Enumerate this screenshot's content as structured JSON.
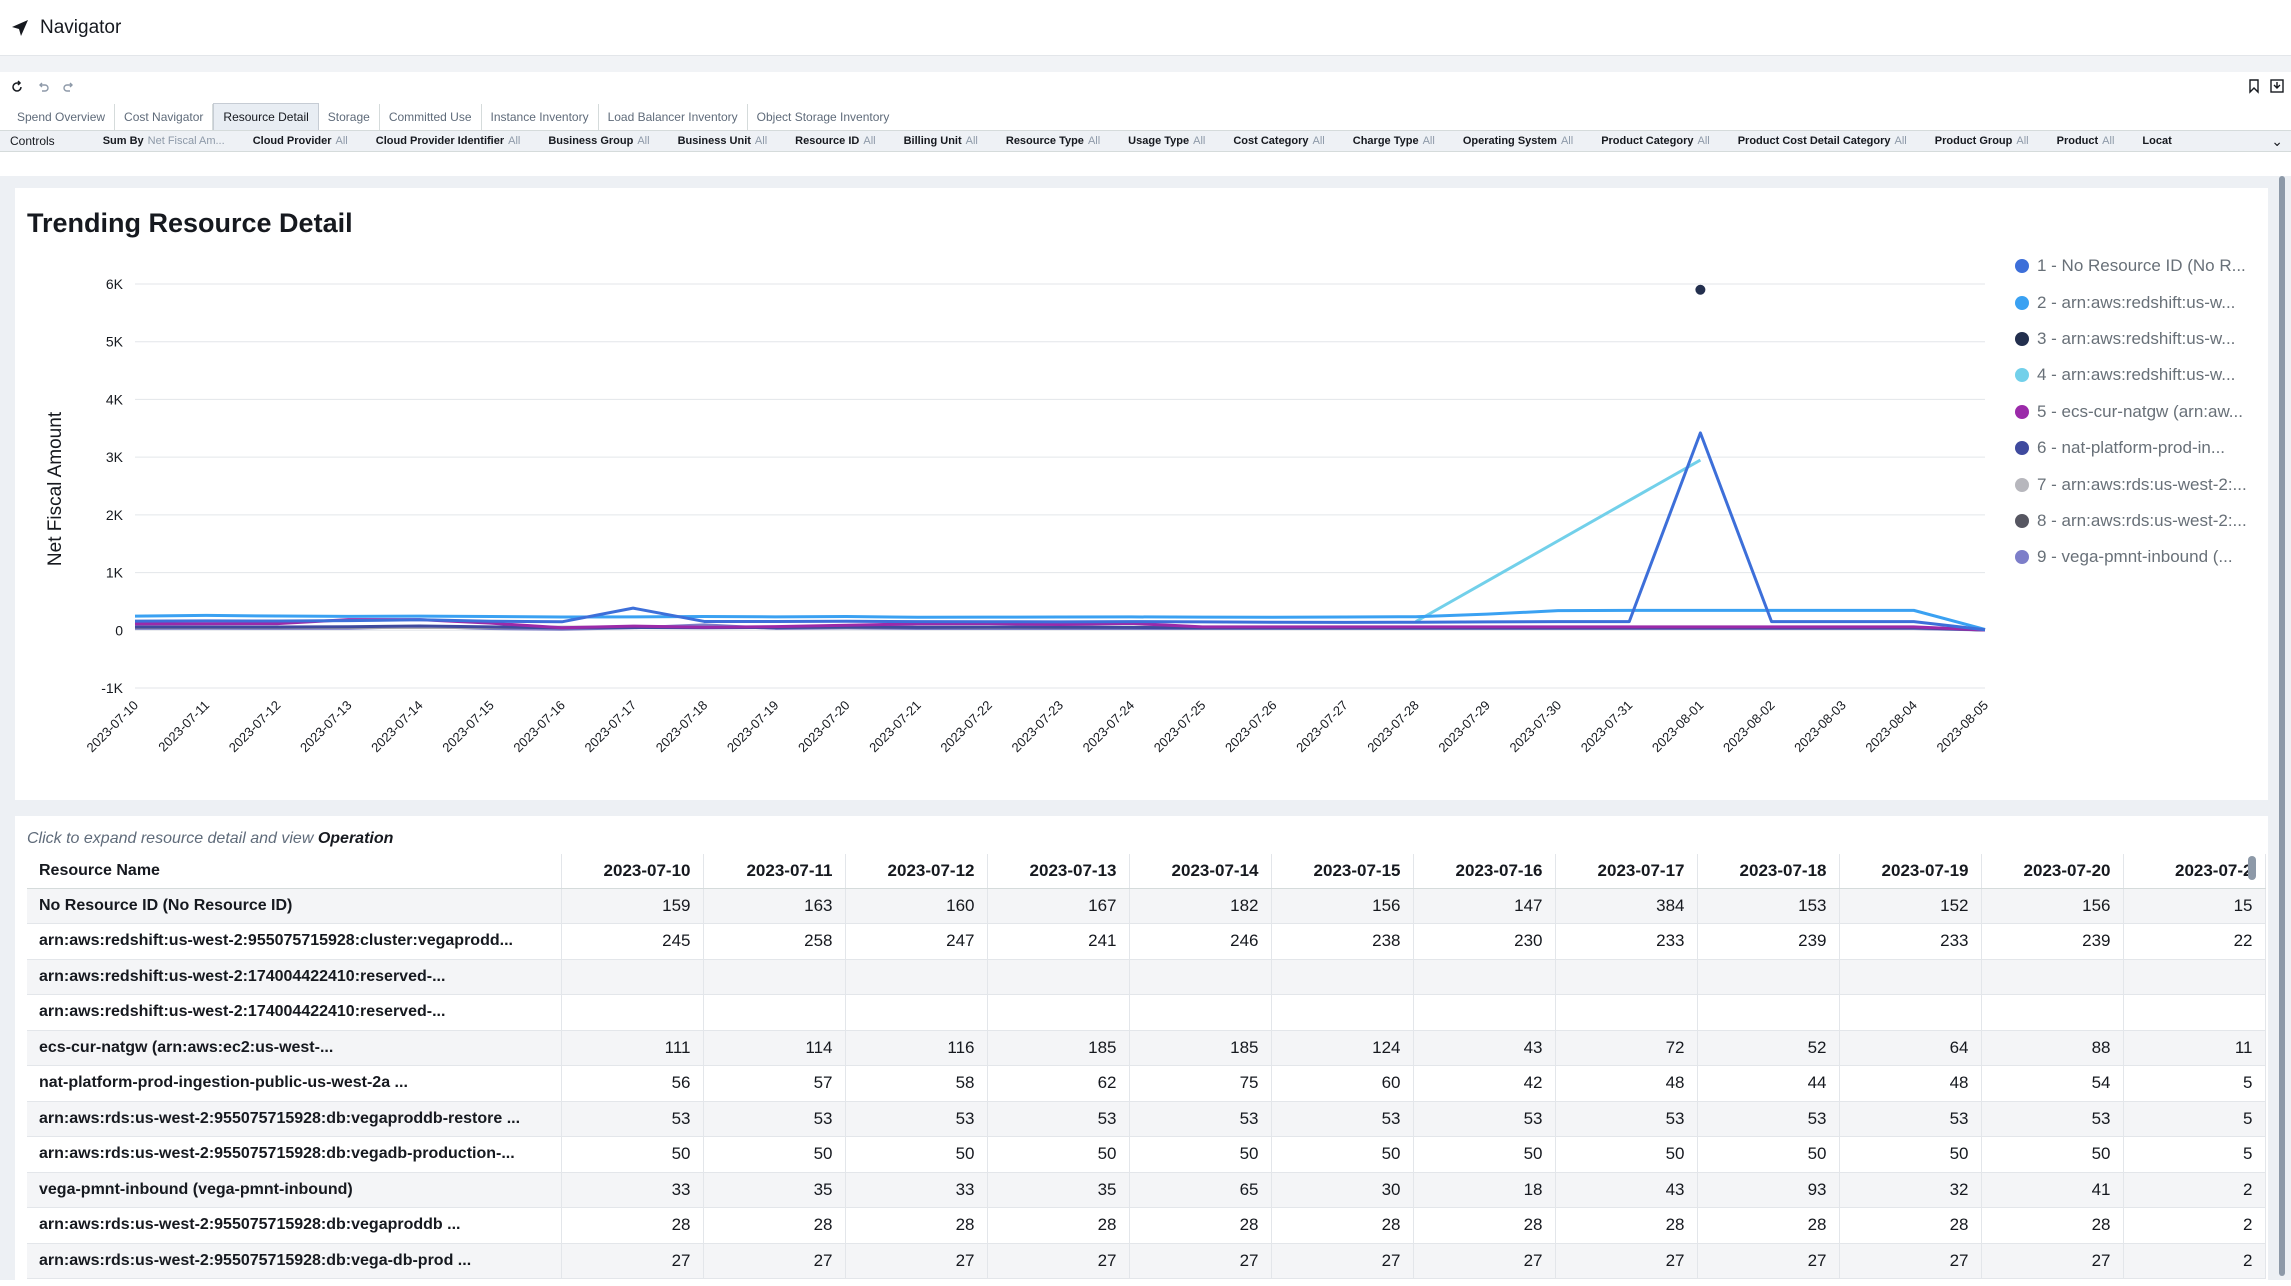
{
  "app": {
    "title": "Navigator"
  },
  "tabs": [
    "Spend Overview",
    "Cost Navigator",
    "Resource Detail",
    "Storage",
    "Committed Use",
    "Instance Inventory",
    "Load Balancer Inventory",
    "Object Storage Inventory"
  ],
  "active_tab": "Resource Detail",
  "controls": {
    "label": "Controls",
    "items": [
      {
        "name": "Sum By",
        "value": "Net Fiscal Am..."
      },
      {
        "name": "Cloud Provider",
        "value": "All"
      },
      {
        "name": "Cloud Provider Identifier",
        "value": "All"
      },
      {
        "name": "Business Group",
        "value": "All"
      },
      {
        "name": "Business Unit",
        "value": "All"
      },
      {
        "name": "Resource ID",
        "value": "All"
      },
      {
        "name": "Billing Unit",
        "value": "All"
      },
      {
        "name": "Resource Type",
        "value": "All"
      },
      {
        "name": "Usage Type",
        "value": "All"
      },
      {
        "name": "Cost Category",
        "value": "All"
      },
      {
        "name": "Charge Type",
        "value": "All"
      },
      {
        "name": "Operating System",
        "value": "All"
      },
      {
        "name": "Product Category",
        "value": "All"
      },
      {
        "name": "Product Cost Detail Category",
        "value": "All"
      },
      {
        "name": "Product Group",
        "value": "All"
      },
      {
        "name": "Product",
        "value": "All"
      },
      {
        "name": "Locat",
        "value": ""
      }
    ]
  },
  "chart": {
    "title": "Trending Resource Detail",
    "ylabel": "Net Fiscal Amount",
    "y_ticks": [
      "6K",
      "5K",
      "4K",
      "3K",
      "2K",
      "1K",
      "0",
      "-1K"
    ]
  },
  "chart_data": {
    "type": "line",
    "title": "Trending Resource Detail",
    "xlabel": "",
    "ylabel": "Net Fiscal Amount",
    "ylim": [
      -1000,
      6000
    ],
    "x": [
      "2023-07-10",
      "2023-07-11",
      "2023-07-12",
      "2023-07-13",
      "2023-07-14",
      "2023-07-15",
      "2023-07-16",
      "2023-07-17",
      "2023-07-18",
      "2023-07-19",
      "2023-07-20",
      "2023-07-21",
      "2023-07-22",
      "2023-07-23",
      "2023-07-24",
      "2023-07-25",
      "2023-07-26",
      "2023-07-27",
      "2023-07-28",
      "2023-07-29",
      "2023-07-30",
      "2023-07-31",
      "2023-08-01",
      "2023-08-02",
      "2023-08-03",
      "2023-08-04",
      "2023-08-05"
    ],
    "legend_position": "right",
    "series": [
      {
        "name": "1 - No Resource ID (No R...",
        "color": "#3d6fd9",
        "values": [
          159,
          163,
          160,
          167,
          182,
          156,
          147,
          384,
          153,
          152,
          156,
          150,
          148,
          146,
          150,
          145,
          140,
          138,
          140,
          145,
          150,
          150,
          3420,
          150,
          150,
          150,
          10
        ]
      },
      {
        "name": "2 - arn:aws:redshift:us-w...",
        "color": "#3aa1f2",
        "values": [
          245,
          258,
          247,
          241,
          246,
          238,
          230,
          233,
          239,
          233,
          239,
          225,
          228,
          230,
          232,
          228,
          225,
          230,
          235,
          280,
          340,
          345,
          345,
          345,
          345,
          345,
          15
        ]
      },
      {
        "name": "3 - arn:aws:redshift:us-w...",
        "color": "#232f4e",
        "values": [
          null,
          null,
          null,
          null,
          null,
          null,
          null,
          null,
          null,
          null,
          null,
          null,
          null,
          null,
          null,
          null,
          null,
          null,
          null,
          null,
          null,
          null,
          5900,
          null,
          null,
          null,
          null
        ]
      },
      {
        "name": "4 - arn:aws:redshift:us-w...",
        "color": "#72d0ea",
        "values": [
          null,
          null,
          null,
          null,
          null,
          null,
          null,
          null,
          null,
          null,
          null,
          null,
          null,
          null,
          null,
          null,
          null,
          null,
          150,
          null,
          null,
          null,
          2950,
          null,
          null,
          null,
          null
        ]
      },
      {
        "name": "5 - ecs-cur-natgw (arn:aw...",
        "color": "#9b2aa9",
        "values": [
          111,
          114,
          116,
          185,
          185,
          124,
          43,
          72,
          52,
          64,
          88,
          110,
          115,
          100,
          120,
          60,
          60,
          60,
          60,
          60,
          60,
          60,
          60,
          60,
          60,
          60,
          5
        ]
      },
      {
        "name": "6 - nat-platform-prod-in...",
        "color": "#3f4a9e",
        "values": [
          56,
          57,
          58,
          62,
          75,
          60,
          42,
          48,
          44,
          48,
          54,
          50,
          55,
          52,
          50,
          45,
          45,
          45,
          45,
          45,
          45,
          45,
          45,
          45,
          45,
          45,
          5
        ]
      },
      {
        "name": "7 - arn:aws:rds:us-west-2:...",
        "color": "#b7b7bd",
        "values": [
          53,
          53,
          53,
          53,
          53,
          53,
          53,
          53,
          53,
          53,
          53,
          53,
          53,
          53,
          53,
          53,
          53,
          53,
          53,
          53,
          53,
          53,
          53,
          53,
          53,
          53,
          5
        ]
      },
      {
        "name": "8 - arn:aws:rds:us-west-2:...",
        "color": "#565661",
        "values": [
          50,
          50,
          50,
          50,
          50,
          50,
          50,
          50,
          50,
          50,
          50,
          50,
          50,
          50,
          50,
          50,
          50,
          50,
          50,
          50,
          50,
          50,
          50,
          50,
          50,
          50,
          5
        ]
      },
      {
        "name": "9 - vega-pmnt-inbound (...",
        "color": "#7d7ec9",
        "values": [
          33,
          35,
          33,
          35,
          65,
          30,
          18,
          43,
          93,
          32,
          41,
          30,
          30,
          30,
          30,
          30,
          30,
          30,
          30,
          30,
          30,
          30,
          30,
          30,
          30,
          30,
          5
        ]
      }
    ]
  },
  "table": {
    "hint_prefix": "Click to expand resource detail and view ",
    "hint_bold": "Operation",
    "first_col_header": "Resource Name",
    "date_headers": [
      "2023-07-10",
      "2023-07-11",
      "2023-07-12",
      "2023-07-13",
      "2023-07-14",
      "2023-07-15",
      "2023-07-16",
      "2023-07-17",
      "2023-07-18",
      "2023-07-19",
      "2023-07-20",
      "2023-07-2"
    ],
    "rows": [
      {
        "name": "No Resource ID (No Resource ID)",
        "values": [
          "159",
          "163",
          "160",
          "167",
          "182",
          "156",
          "147",
          "384",
          "153",
          "152",
          "156",
          "15"
        ]
      },
      {
        "name": "arn:aws:redshift:us-west-2:955075715928:cluster:vegaprodd...",
        "values": [
          "245",
          "258",
          "247",
          "241",
          "246",
          "238",
          "230",
          "233",
          "239",
          "233",
          "239",
          "22"
        ]
      },
      {
        "name": "arn:aws:redshift:us-west-2:174004422410:reserved-...",
        "values": [
          "",
          "",
          "",
          "",
          "",
          "",
          "",
          "",
          "",
          "",
          "",
          ""
        ]
      },
      {
        "name": "arn:aws:redshift:us-west-2:174004422410:reserved-...",
        "values": [
          "",
          "",
          "",
          "",
          "",
          "",
          "",
          "",
          "",
          "",
          "",
          ""
        ]
      },
      {
        "name": "ecs-cur-natgw (arn:aws:ec2:us-west-...",
        "values": [
          "111",
          "114",
          "116",
          "185",
          "185",
          "124",
          "43",
          "72",
          "52",
          "64",
          "88",
          "11"
        ]
      },
      {
        "name": "nat-platform-prod-ingestion-public-us-west-2a ...",
        "values": [
          "56",
          "57",
          "58",
          "62",
          "75",
          "60",
          "42",
          "48",
          "44",
          "48",
          "54",
          "5"
        ]
      },
      {
        "name": "arn:aws:rds:us-west-2:955075715928:db:vegaproddb-restore ...",
        "values": [
          "53",
          "53",
          "53",
          "53",
          "53",
          "53",
          "53",
          "53",
          "53",
          "53",
          "53",
          "5"
        ]
      },
      {
        "name": "arn:aws:rds:us-west-2:955075715928:db:vegadb-production-...",
        "values": [
          "50",
          "50",
          "50",
          "50",
          "50",
          "50",
          "50",
          "50",
          "50",
          "50",
          "50",
          "5"
        ]
      },
      {
        "name": "vega-pmnt-inbound (vega-pmnt-inbound)",
        "values": [
          "33",
          "35",
          "33",
          "35",
          "65",
          "30",
          "18",
          "43",
          "93",
          "32",
          "41",
          "2"
        ]
      },
      {
        "name": "arn:aws:rds:us-west-2:955075715928:db:vegaproddb ...",
        "values": [
          "28",
          "28",
          "28",
          "28",
          "28",
          "28",
          "28",
          "28",
          "28",
          "28",
          "28",
          "2"
        ]
      },
      {
        "name": "arn:aws:rds:us-west-2:955075715928:db:vega-db-prod ...",
        "values": [
          "27",
          "27",
          "27",
          "27",
          "27",
          "27",
          "27",
          "27",
          "27",
          "27",
          "27",
          "2"
        ]
      }
    ]
  }
}
